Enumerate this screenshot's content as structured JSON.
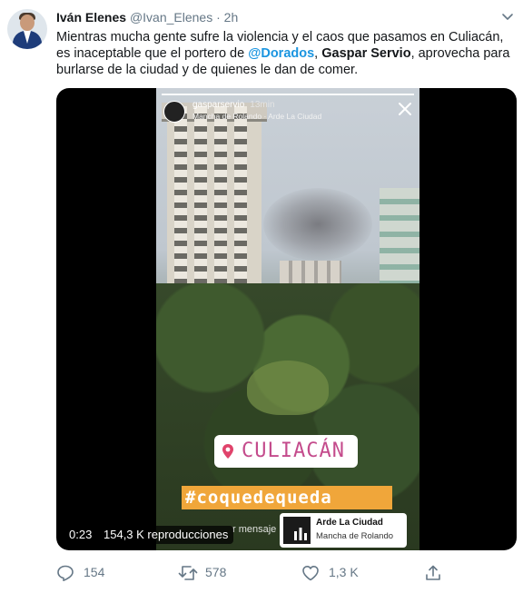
{
  "tweet": {
    "display_name": "Iván Elenes",
    "handle": "@Ivan_Elenes",
    "separator": "·",
    "time": "2h",
    "text_part1": "Mientras mucha gente sufre la violencia y el caos que pasamos en Culiacán, es inaceptable que el portero de ",
    "mention": "@Dorados",
    "text_part2": ", ",
    "bold_name": "Gaspar Servio",
    "text_part3": ", aprovecha para burlarse de la ciudad y de quienes le dan de comer."
  },
  "video": {
    "elapsed": "0:23",
    "views": "154,3 K reproducciones",
    "story": {
      "username": "gasparservio",
      "time_ago": "13min",
      "location_line": "Mancha de Rolando · Arde La Ciudad",
      "location_sticker": "CULIACÁN",
      "hashtag_sticker": "#coquedequeda",
      "message_hint": "r mensaje",
      "music_title": "Arde La Ciudad",
      "music_artist": "Mancha de Rolando"
    }
  },
  "actions": {
    "replies": "154",
    "retweets": "578",
    "likes": "1,3 K"
  },
  "icons": {
    "avatar": "avatar",
    "caret": "chevron-down-icon",
    "reply": "reply-icon",
    "retweet": "retweet-icon",
    "like": "heart-icon",
    "share": "share-icon"
  },
  "colors": {
    "link": "#1b95e0",
    "muted": "#657786",
    "text": "#14171a"
  }
}
